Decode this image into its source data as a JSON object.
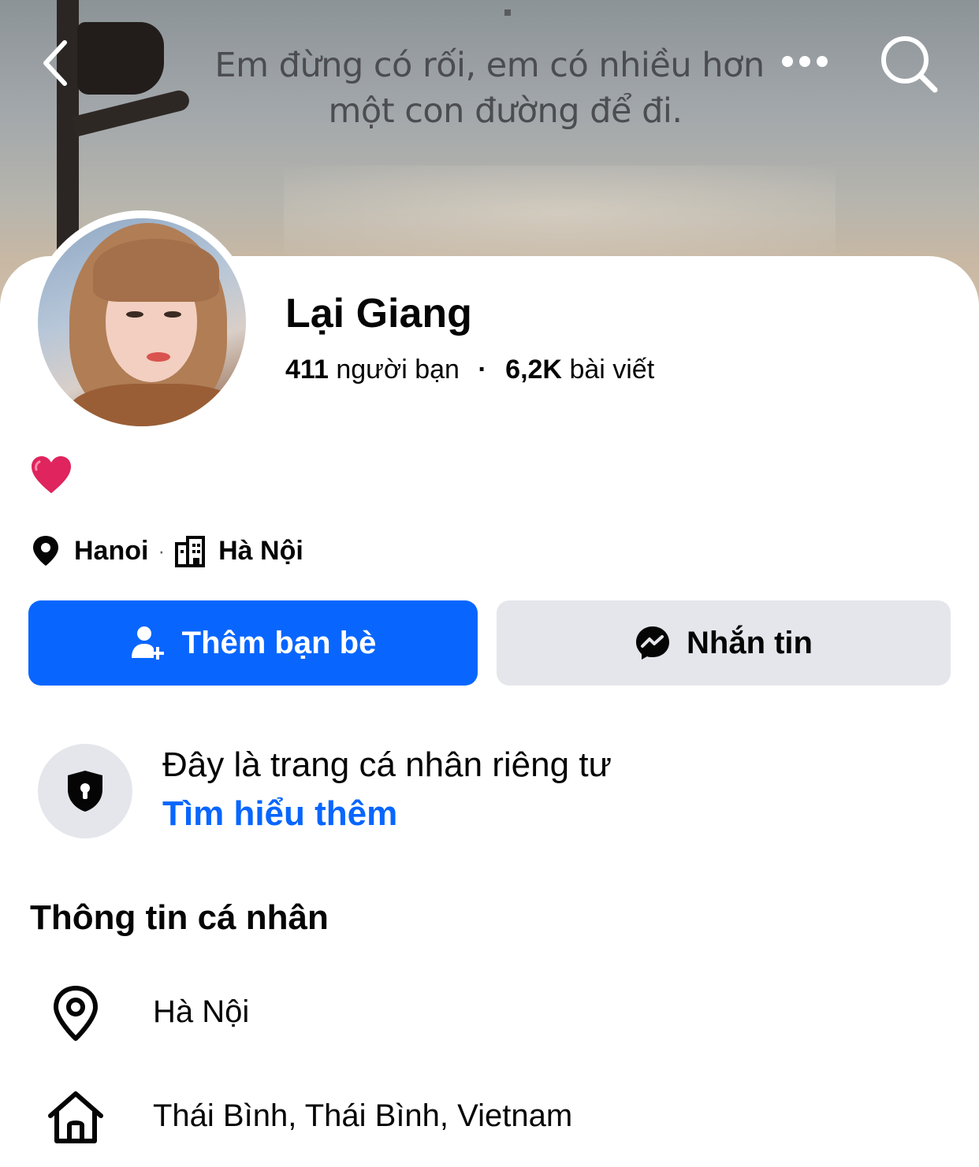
{
  "cover": {
    "quote_line1": "Em đừng có rối, em có nhiều hơn",
    "quote_line2": "một con đường để đi."
  },
  "nav": {
    "back_icon": "chevron-left-icon",
    "more_icon": "more-dots-icon",
    "search_icon": "search-icon"
  },
  "profile": {
    "name": "Lại Giang",
    "friends_count": "411",
    "friends_label": "người bạn",
    "stats_separator": "·",
    "posts_count": "6,2K",
    "posts_label": "bài viết",
    "bio_emoji": "heart-icon"
  },
  "location_row": {
    "current_city": "Hanoi",
    "separator": "·",
    "hometown_short": "Hà Nội"
  },
  "actions": {
    "add_friend_label": "Thêm bạn bè",
    "message_label": "Nhắn tin"
  },
  "privacy": {
    "title": "Đây là trang cá nhân riêng tư",
    "link": "Tìm hiểu thêm"
  },
  "about": {
    "section_title": "Thông tin cá nhân",
    "items": [
      {
        "icon": "location-pin-icon",
        "text": "Hà Nội"
      },
      {
        "icon": "home-icon",
        "text": "Thái Bình, Thái Bình, Vietnam"
      }
    ]
  },
  "colors": {
    "primary_blue": "#0866ff",
    "secondary_gray": "#e4e6eb",
    "text_dark": "#050505",
    "heart_red": "#e0245e"
  }
}
